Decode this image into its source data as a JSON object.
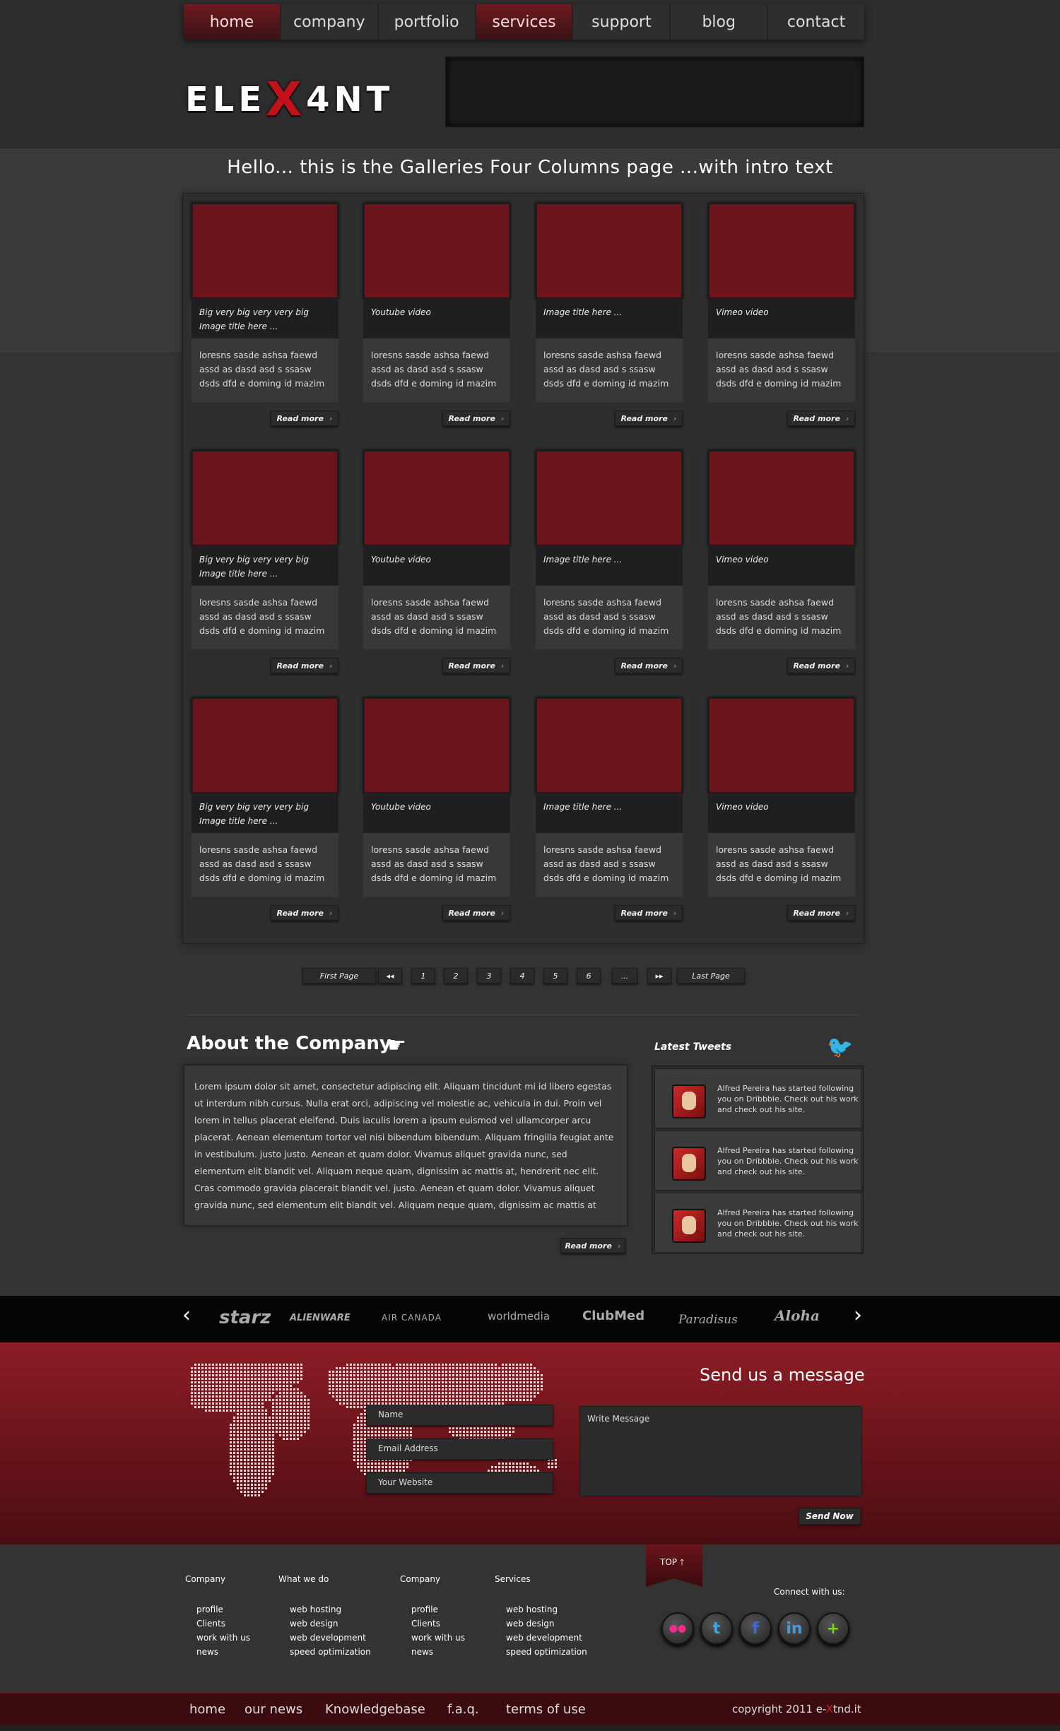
{
  "nav": {
    "items": [
      {
        "label": "home",
        "active": true
      },
      {
        "label": "company",
        "active": false
      },
      {
        "label": "portfolio",
        "active": false
      },
      {
        "label": "services",
        "active": true
      },
      {
        "label": "support",
        "active": false
      },
      {
        "label": "blog",
        "active": false
      },
      {
        "label": "contact",
        "active": false
      }
    ]
  },
  "logo": {
    "part1": "ELE",
    "x": "X",
    "part2": "4NT"
  },
  "intro": "Hello... this is the Galleries Four Columns page  ...with intro text",
  "gallery": {
    "read_more": "Read more",
    "description": "loresns sasde ashsa faewd assd as dasd asd   s ssasw dsds dfd e doming id mazim",
    "captions": [
      "Big very big very very big Image title here ...",
      "Youtube video",
      "Image title here ...",
      "Vimeo video"
    ]
  },
  "pager": {
    "first": "First Page",
    "prev": "◂◂",
    "pages": [
      "1",
      "2",
      "3",
      "4",
      "5",
      "6",
      "..."
    ],
    "next": "▸▸",
    "last": "Last Page"
  },
  "about": {
    "title": "About the Company",
    "text": "Lorem ipsum dolor sit amet, consectetur adipiscing elit. Aliquam tincidunt mi id libero egestas ut interdum nibh cursus. Nulla erat orci, adipiscing vel molestie ac, vehicula in dui. Proin vel lorem in tellus placerat eleifend. Duis iaculis lorem a ipsum euismod vel ullamcorper arcu placerat. Aenean elementum tortor vel nisi bibendum bibendum. Aliquam fringilla feugiat ante in vestibulum. justo justo. Aenean et quam dolor. Vivamus aliquet gravida nunc, sed elementum elit blandit vel. Aliquam neque quam, dignissim ac mattis at, hendrerit nec elit. Cras commodo gravida placerait blandit vel. justo. Aenean et quam dolor. Vivamus aliquet gravida nunc, sed elementum elit blandit vel. Aliquam neque quam, dignissim ac mattis at",
    "read_more": "Read more"
  },
  "tweets": {
    "title": "Latest Tweets",
    "items": [
      "Alfred Pereira has started following you on Dribbble. Check out his work and check out his site.",
      "Alfred Pereira has started following you on Dribbble. Check out his work and check out his site.",
      "Alfred Pereira has started following you on Dribbble. Check out his work and check out his site."
    ]
  },
  "clients": [
    "starz",
    "ALIENWARE",
    "AIR CANADA",
    "worldmedia",
    "ClubMed",
    "Paradisus",
    "Aloha"
  ],
  "contact": {
    "title": "Send us a message",
    "name_placeholder": "Name",
    "email_placeholder": "Email Address",
    "website_placeholder": "Your Website",
    "message_placeholder": "Write Message",
    "send_label": "Send Now"
  },
  "top_label": "TOP",
  "footer": {
    "columns": [
      {
        "title": "Company",
        "items": [
          "profile",
          "Clients",
          "work with us",
          "news"
        ]
      },
      {
        "title": "What we do",
        "items": [
          "web hosting",
          "web design",
          "web development",
          "speed optimization"
        ]
      },
      {
        "title": "Company",
        "items": [
          "profile",
          "Clients",
          "work with us",
          "news"
        ]
      },
      {
        "title": "Services",
        "items": [
          "web hosting",
          "web design",
          "web development",
          "speed optimization"
        ]
      }
    ],
    "connect": "Connect with us:",
    "social": [
      {
        "name": "flickr",
        "glyph": "●●",
        "color": "#ff2a8a"
      },
      {
        "name": "twitter",
        "glyph": "t",
        "color": "#3aa9e8"
      },
      {
        "name": "facebook",
        "glyph": "f",
        "color": "#3b6bd8"
      },
      {
        "name": "linkedin",
        "glyph": "in",
        "color": "#4a9bd8"
      },
      {
        "name": "plus",
        "glyph": "+",
        "color": "#7ed321"
      }
    ]
  },
  "bottom": {
    "links": [
      "home",
      "our news",
      "Knowledgebase",
      "f.a.q.",
      "terms of use"
    ],
    "copyright_a": "copyright 2011 e-",
    "copyright_x": "X",
    "copyright_b": "tnd.it"
  }
}
